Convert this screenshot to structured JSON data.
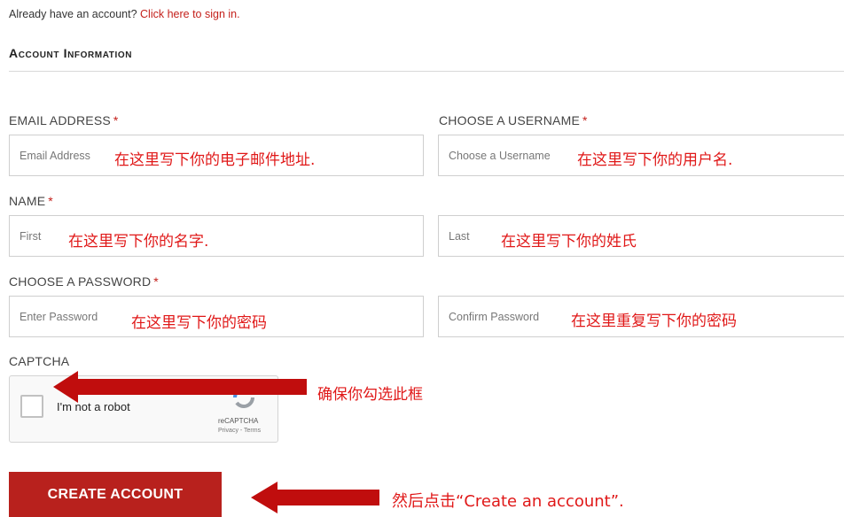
{
  "signin": {
    "prompt": "Already have an account?",
    "link": "Click here to sign in."
  },
  "section_title": "Account Information",
  "fields": {
    "email": {
      "label": "EMAIL ADDRESS",
      "required": "*",
      "placeholder": "Email Address",
      "note": "在这里写下你的电子邮件地址."
    },
    "username": {
      "label": "CHOOSE A USERNAME",
      "required": "*",
      "placeholder": "Choose a Username",
      "note": "在这里写下你的用户名."
    },
    "name": {
      "label": "NAME",
      "required": "*",
      "first_placeholder": "First",
      "first_note": "在这里写下你的名字.",
      "last_placeholder": "Last",
      "last_note": "在这里写下你的姓氏"
    },
    "password": {
      "label": "CHOOSE A PASSWORD",
      "required": "*",
      "placeholder": "Enter Password",
      "note": "在这里写下你的密码",
      "confirm_placeholder": "Confirm Password",
      "confirm_note": "在这里重复写下你的密码"
    }
  },
  "captcha": {
    "label": "CAPTCHA",
    "checkbox_text": "I'm not a robot",
    "brand": "reCAPTCHA",
    "links": "Privacy - Terms",
    "note": "确保你勾选此框"
  },
  "create_button": {
    "label": "CREATE ACCOUNT",
    "note": "然后点击“Create an account”."
  },
  "colors": {
    "accent_red": "#c4201b",
    "button_red": "#b8211d",
    "annotation_red": "#c00d0d"
  },
  "icons": [
    "left-arrow-annotation-icon",
    "recaptcha-logo-icon"
  ]
}
